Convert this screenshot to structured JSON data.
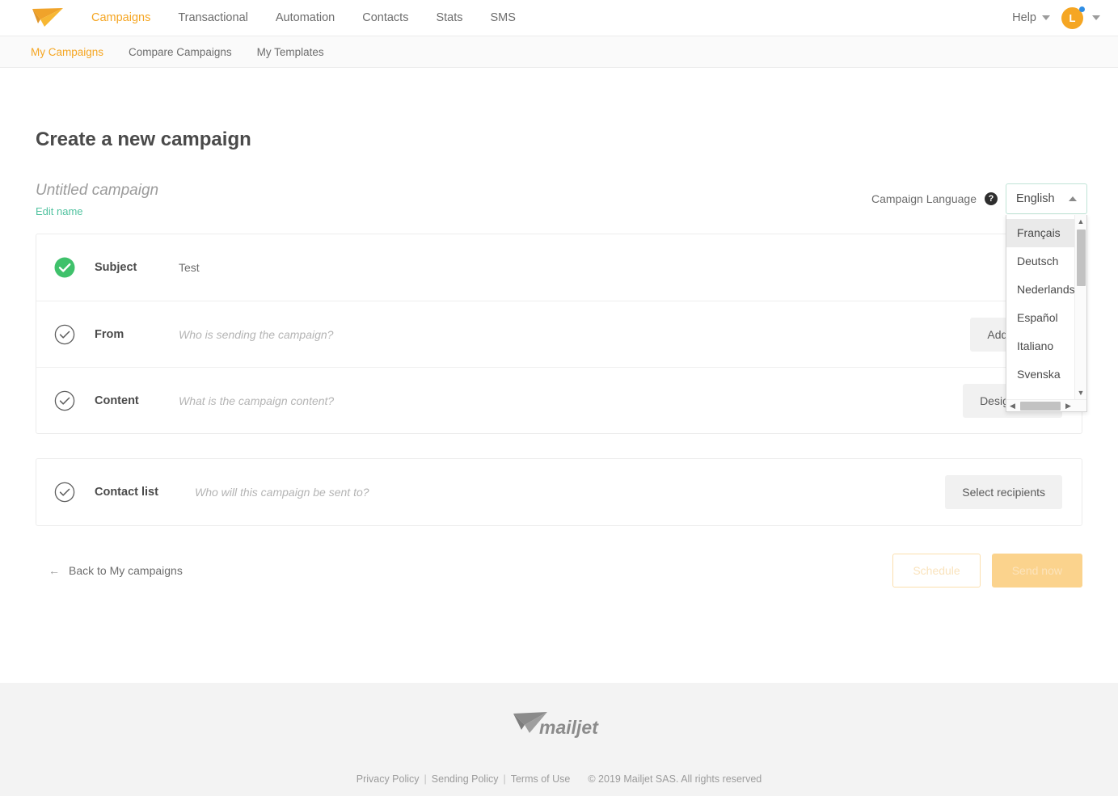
{
  "header": {
    "logo_icon": "mailjet-paper-plane-logo",
    "nav": [
      {
        "label": "Campaigns",
        "active": true
      },
      {
        "label": "Transactional",
        "active": false
      },
      {
        "label": "Automation",
        "active": false
      },
      {
        "label": "Contacts",
        "active": false
      },
      {
        "label": "Stats",
        "active": false
      },
      {
        "label": "SMS",
        "active": false
      }
    ],
    "help_label": "Help",
    "help_caret_icon": "chevron-down-icon",
    "avatar_initial": "L",
    "avatar_caret_icon": "chevron-down-icon",
    "avatar_badge_color": "#2f8de4"
  },
  "subnav": [
    {
      "label": "My Campaigns",
      "active": true
    },
    {
      "label": "Compare Campaigns",
      "active": false
    },
    {
      "label": "My Templates",
      "active": false
    }
  ],
  "main": {
    "page_title": "Create a new campaign",
    "campaign_name": "Untitled campaign",
    "edit_name_label": "Edit name",
    "language": {
      "label": "Campaign Language",
      "help_icon": "question-mark-icon",
      "selected": "English",
      "caret_icon": "chevron-up-icon",
      "open": true,
      "options": [
        {
          "label": "Français",
          "highlighted": true
        },
        {
          "label": "Deutsch",
          "highlighted": false
        },
        {
          "label": "Nederlands",
          "highlighted": false
        },
        {
          "label": "Español",
          "highlighted": false
        },
        {
          "label": "Italiano",
          "highlighted": false
        },
        {
          "label": "Svenska",
          "highlighted": false
        }
      ],
      "scroll_up_icon": "chevron-up-icon",
      "scroll_down_icon": "chevron-down-icon",
      "scroll_left_icon": "chevron-left-icon",
      "scroll_right_icon": "chevron-right-icon"
    },
    "steps_primary": [
      {
        "id": "subject",
        "label": "Subject",
        "state": "complete",
        "check_icon": "check-circle-filled-icon",
        "value": "Test",
        "hint": "",
        "action_label": ""
      },
      {
        "id": "from",
        "label": "From",
        "state": "incomplete",
        "check_icon": "check-circle-outline-icon",
        "value": "",
        "hint": "Who is sending the campaign?",
        "action_label": "Add sender"
      },
      {
        "id": "content",
        "label": "Content",
        "state": "incomplete",
        "check_icon": "check-circle-outline-icon",
        "value": "",
        "hint": "What is the campaign content?",
        "action_label": "Design email"
      }
    ],
    "steps_secondary": [
      {
        "id": "contact-list",
        "label": "Contact list",
        "state": "incomplete",
        "check_icon": "check-circle-outline-icon",
        "value": "",
        "hint": "Who will this campaign be sent to?",
        "action_label": "Select recipients"
      }
    ],
    "back_link": "Back to My campaigns",
    "back_arrow_icon": "arrow-left-icon",
    "schedule_label": "Schedule",
    "send_now_label": "Send now"
  },
  "footer": {
    "logo_icon": "mailjet-wordmark-logo",
    "privacy_policy": "Privacy Policy",
    "sending_policy": "Sending Policy",
    "terms_of_use": "Terms of Use",
    "separator": "|",
    "copyright": "© 2019 Mailjet SAS. All rights reserved"
  },
  "colors": {
    "accent_orange": "#f5a623",
    "success_green": "#3fc16b",
    "link_teal": "#52c3a0",
    "text_dark": "#4a4a4a",
    "text_muted": "#9b9b9b"
  }
}
